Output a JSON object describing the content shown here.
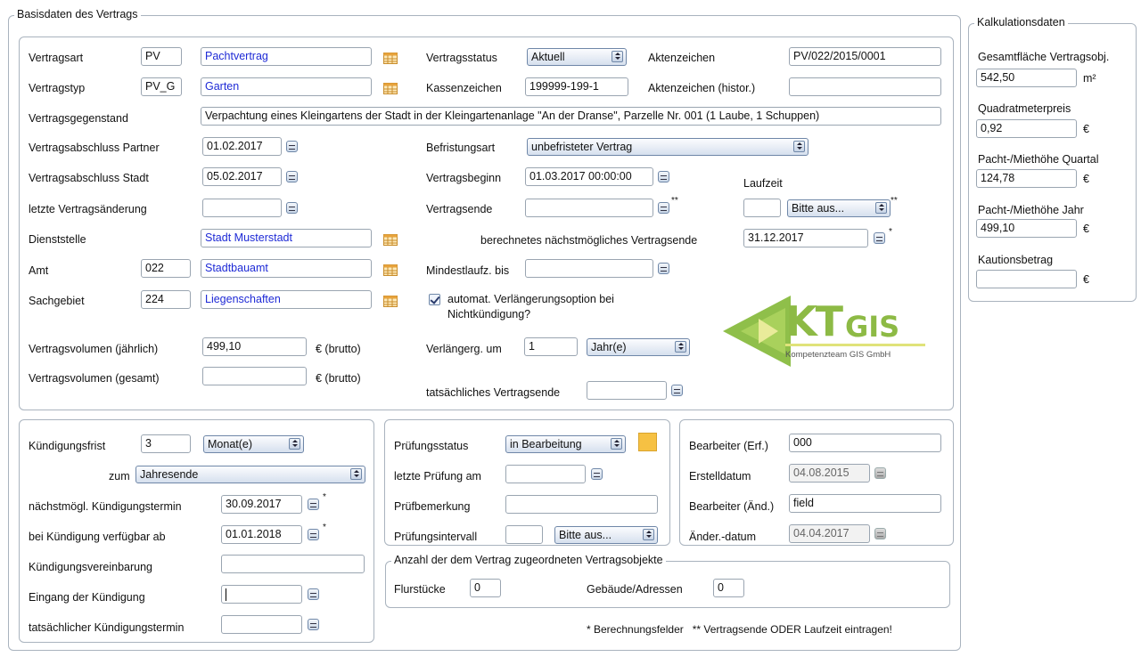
{
  "basisdaten": {
    "legend": "Basisdaten des Vertrags",
    "vertragsart": {
      "label": "Vertragsart",
      "code": "PV",
      "value": "Pachtvertrag"
    },
    "vertragstyp": {
      "label": "Vertragstyp",
      "code": "PV_G",
      "value": "Garten"
    },
    "vertragsstatus": {
      "label": "Vertragsstatus",
      "value": "Aktuell"
    },
    "aktenzeichen": {
      "label": "Aktenzeichen",
      "value": "PV/022/2015/0001"
    },
    "kassenzeichen": {
      "label": "Kassenzeichen",
      "value": "199999-199-1"
    },
    "aktenzeichen_histor": {
      "label": "Aktenzeichen (histor.)",
      "value": ""
    },
    "vertragsgegenstand": {
      "label": "Vertragsgegenstand",
      "value": "Verpachtung eines Kleingartens der Stadt in der Kleingartenanlage \"An der Dranse\", Parzelle Nr. 001 (1 Laube, 1 Schuppen)"
    },
    "abschluss_partner": {
      "label": "Vertragsabschluss Partner",
      "value": "01.02.2017"
    },
    "abschluss_stadt": {
      "label": "Vertragsabschluss Stadt",
      "value": "05.02.2017"
    },
    "letzte_aenderung": {
      "label": "letzte Vertragsänderung",
      "value": ""
    },
    "befristungsart": {
      "label": "Befristungsart",
      "value": "unbefristeter Vertrag"
    },
    "vertragsbeginn": {
      "label": "Vertragsbeginn",
      "value": "01.03.2017 00:00:00"
    },
    "vertragsende": {
      "label": "Vertragsende",
      "value": "",
      "mark": "**"
    },
    "laufzeit": {
      "label": "Laufzeit",
      "value": "",
      "unit": "Bitte aus...",
      "mark": "**"
    },
    "dienststelle": {
      "label": "Dienststelle",
      "value": "Stadt Musterstadt"
    },
    "amt": {
      "label": "Amt",
      "code": "022",
      "value": "Stadtbauamt"
    },
    "sachgebiet": {
      "label": "Sachgebiet",
      "code": "224",
      "value": "Liegenschaften"
    },
    "berechnetes_ende": {
      "label": "berechnetes nächstmögliches Vertragsende",
      "value": "31.12.2017",
      "mark": "*"
    },
    "mindestlaufz": {
      "label": "Mindestlaufz. bis",
      "value": ""
    },
    "verlaengerung_option": {
      "label_line1": "automat. Verlängerungsoption bei",
      "label_line2": "Nichtkündigung?",
      "checked": true
    },
    "verlaengerung_um": {
      "label": "Verlängerg. um",
      "value": "1",
      "unit": "Jahr(e)"
    },
    "volumen_jaehrlich": {
      "label": "Vertragsvolumen (jährlich)",
      "value": "499,10",
      "suffix": "€ (brutto)"
    },
    "volumen_gesamt": {
      "label": "Vertragsvolumen (gesamt)",
      "value": "",
      "suffix": "€ (brutto)"
    },
    "tatsaechliches_ende": {
      "label": "tatsächliches Vertragsende",
      "value": ""
    },
    "logo": {
      "brand_kt": "KT",
      "brand_gis": "GIS",
      "tagline": "Kompetenzteam GIS GmbH"
    }
  },
  "kalkulation": {
    "legend": "Kalkulationsdaten",
    "gesamtflaeche": {
      "label": "Gesamtfläche Vertragsobj.",
      "value": "542,50",
      "unit": "m²"
    },
    "qm_preis": {
      "label": "Quadratmeterpreis",
      "value": "0,92",
      "unit": "€"
    },
    "quartal": {
      "label": "Pacht-/Miethöhe Quartal",
      "value": "124,78",
      "unit": "€"
    },
    "jahr": {
      "label": "Pacht-/Miethöhe Jahr",
      "value": "499,10",
      "unit": "€"
    },
    "kaution": {
      "label": "Kautionsbetrag",
      "value": "",
      "unit": "€"
    }
  },
  "kuendigung": {
    "frist": {
      "label": "Kündigungsfrist",
      "value": "3",
      "unit": "Monat(e)"
    },
    "zum": {
      "label": "zum",
      "value": "Jahresende"
    },
    "naechstmoegl": {
      "label": "nächstmögl. Kündigungstermin",
      "value": "30.09.2017",
      "mark": "*"
    },
    "verfuegbar_ab": {
      "label": "bei Kündigung verfügbar ab",
      "value": "01.01.2018",
      "mark": "*"
    },
    "vereinbarung": {
      "label": "Kündigungsvereinbarung",
      "value": ""
    },
    "eingang": {
      "label": "Eingang der Kündigung",
      "value": ""
    },
    "tatsaechlich": {
      "label": "tatsächlicher Kündigungstermin",
      "value": ""
    }
  },
  "pruefung": {
    "status": {
      "label": "Prüfungsstatus",
      "value": "in Bearbeitung",
      "color": "#f6c143"
    },
    "letzte": {
      "label": "letzte Prüfung am",
      "value": ""
    },
    "bemerkung": {
      "label": "Prüfbemerkung",
      "value": ""
    },
    "intervall": {
      "label": "Prüfungsintervall",
      "value": "",
      "unit": "Bitte aus..."
    }
  },
  "bearbeiter": {
    "erf": {
      "label": "Bearbeiter (Erf.)",
      "value": "000"
    },
    "erstelldatum": {
      "label": "Erstelldatum",
      "value": "04.08.2015"
    },
    "aend": {
      "label": "Bearbeiter (Änd.)",
      "value": "field"
    },
    "aenderdatum": {
      "label": "Änder.-datum",
      "value": "04.04.2017"
    }
  },
  "vertragsobjekte": {
    "legend": "Anzahl der dem Vertrag zugeordneten Vertragsobjekte",
    "flurstuecke": {
      "label": "Flurstücke",
      "value": "0"
    },
    "gebaeude": {
      "label": "Gebäude/Adressen",
      "value": "0"
    }
  },
  "footnote": "* Berechnungsfelder   ** Vertragsende ODER Laufzeit eintragen!"
}
